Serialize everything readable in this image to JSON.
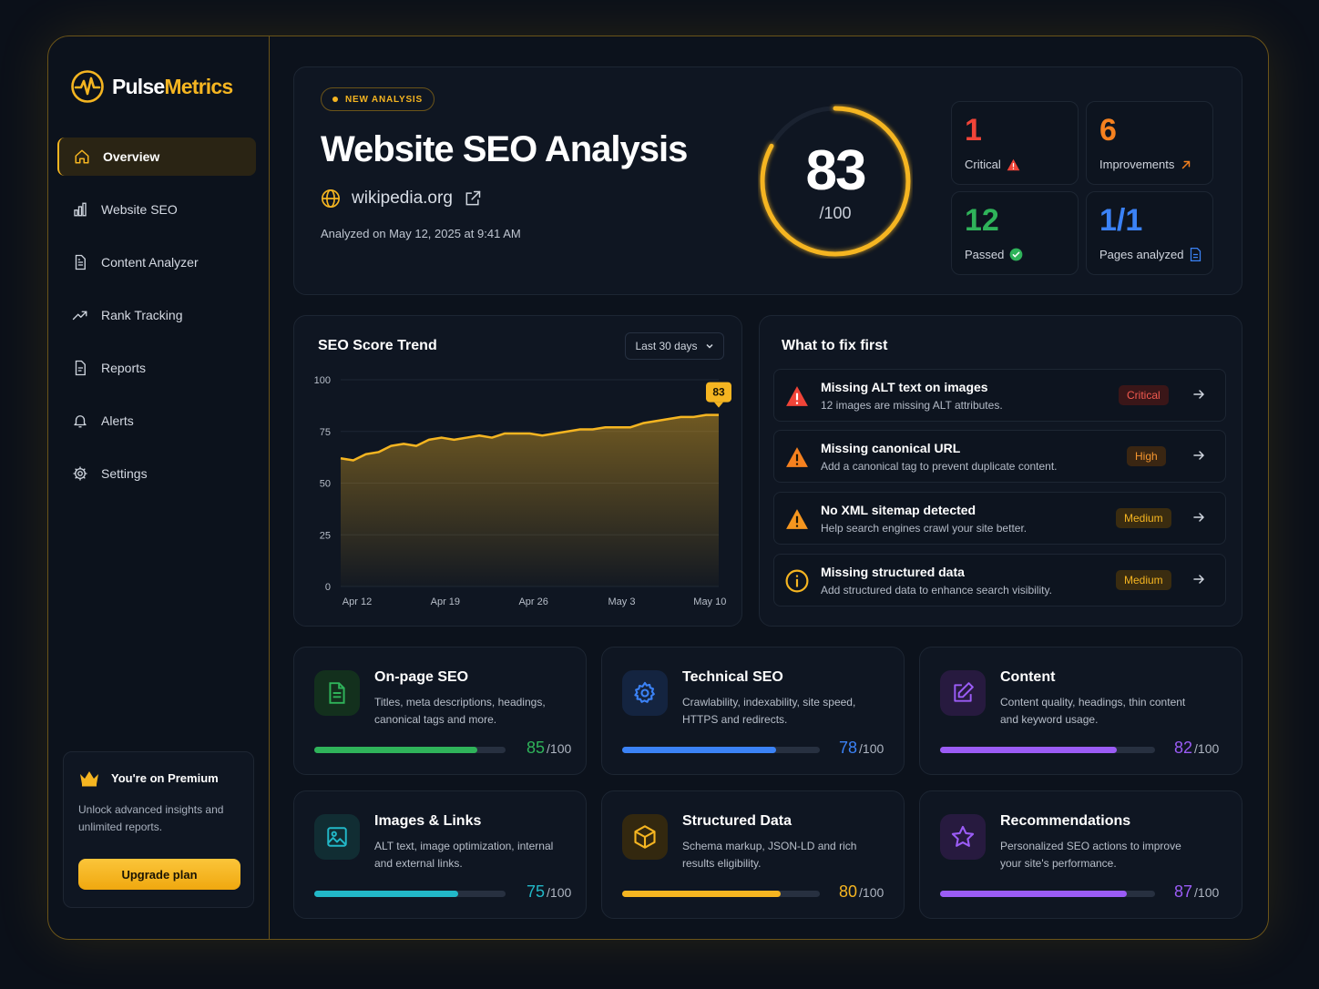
{
  "brand": {
    "name_a": "Pulse",
    "name_b": "Metrics",
    "accent": "#f5b521"
  },
  "nav": {
    "items": [
      {
        "label": "Overview",
        "icon": "home-icon",
        "active": true
      },
      {
        "label": "Website SEO",
        "icon": "bar-chart-icon"
      },
      {
        "label": "Content Analyzer",
        "icon": "document-icon"
      },
      {
        "label": "Rank Tracking",
        "icon": "trending-up-icon"
      },
      {
        "label": "Reports",
        "icon": "report-icon"
      },
      {
        "label": "Alerts",
        "icon": "bell-icon"
      },
      {
        "label": "Settings",
        "icon": "gear-icon"
      }
    ]
  },
  "premium": {
    "title": "You're on Premium",
    "description": "Unlock advanced insights and unlimited reports.",
    "button": "Upgrade plan"
  },
  "hero": {
    "badge": "NEW ANALYSIS",
    "title": "Website SEO Analysis",
    "site": "wikipedia.org",
    "analyzed": "Analyzed on May 12, 2025 at 9:41 AM",
    "score": "83",
    "score_den": "/100",
    "score_fraction": 0.83
  },
  "stats": [
    {
      "value": "1",
      "label": "Critical",
      "color": "#f04438",
      "icon": "warning-icon"
    },
    {
      "value": "6",
      "label": "Improvements",
      "color": "#f5811f",
      "icon": "arrow-up-right-icon"
    },
    {
      "value": "12",
      "label": "Passed",
      "color": "#2fb35a",
      "icon": "check-circle-icon"
    },
    {
      "value": "1/1",
      "label": "Pages analyzed",
      "color": "#3b82f6",
      "icon": "page-icon"
    }
  ],
  "trend": {
    "title": "SEO Score Trend",
    "range": "Last 30 days",
    "latest_label": "83"
  },
  "chart_data": {
    "type": "area",
    "x": [
      "Apr 12",
      "Apr 13",
      "Apr 14",
      "Apr 15",
      "Apr 16",
      "Apr 17",
      "Apr 18",
      "Apr 19",
      "Apr 20",
      "Apr 21",
      "Apr 22",
      "Apr 23",
      "Apr 24",
      "Apr 25",
      "Apr 26",
      "Apr 27",
      "Apr 28",
      "Apr 29",
      "Apr 30",
      "May 1",
      "May 2",
      "May 3",
      "May 4",
      "May 5",
      "May 6",
      "May 7",
      "May 8",
      "May 9",
      "May 10",
      "May 11",
      "May 12"
    ],
    "values": [
      62,
      61,
      64,
      65,
      68,
      69,
      68,
      71,
      72,
      71,
      72,
      73,
      72,
      74,
      74,
      74,
      73,
      74,
      75,
      76,
      76,
      77,
      77,
      77,
      79,
      80,
      81,
      82,
      82,
      83,
      83
    ],
    "xticks": [
      "Apr 12",
      "Apr 19",
      "Apr 26",
      "May 3",
      "May 10"
    ],
    "yticks": [
      0,
      25,
      50,
      75,
      100
    ],
    "ylim": [
      0,
      100
    ],
    "title": "SEO Score Trend",
    "grid": true,
    "color": "#f5b521"
  },
  "fix": {
    "title": "What to fix first",
    "items": [
      {
        "title": "Missing ALT text on images",
        "desc": "12 images are missing ALT attributes.",
        "severity": "Critical",
        "icon": "warning-icon"
      },
      {
        "title": "Missing canonical URL",
        "desc": "Add a canonical tag to prevent duplicate content.",
        "severity": "High",
        "icon": "warning-icon"
      },
      {
        "title": "No XML sitemap detected",
        "desc": "Help search engines crawl your site better.",
        "severity": "Medium",
        "icon": "warning-icon"
      },
      {
        "title": "Missing structured data",
        "desc": "Add structured data to enhance search visibility.",
        "severity": "Medium",
        "icon": "info-icon"
      }
    ]
  },
  "categories": [
    {
      "title": "On-page SEO",
      "desc": "Titles, meta descriptions, headings, canonical tags and more.",
      "score": "85",
      "den": "/100",
      "fraction": 0.85,
      "color": "#2fb35a",
      "icon": "document-icon"
    },
    {
      "title": "Technical SEO",
      "desc": "Crawlability, indexability, site speed, HTTPS and redirects.",
      "score": "78",
      "den": "/100",
      "fraction": 0.78,
      "color": "#3b82f6",
      "icon": "gear-icon"
    },
    {
      "title": "Content",
      "desc": "Content quality, headings, thin content and keyword usage.",
      "score": "82",
      "den": "/100",
      "fraction": 0.82,
      "color": "#9b5cf6",
      "icon": "edit-icon"
    },
    {
      "title": "Images & Links",
      "desc": "ALT text, image optimization, internal and external links.",
      "score": "75",
      "den": "/100",
      "fraction": 0.75,
      "color": "#22b8c8",
      "icon": "image-icon"
    },
    {
      "title": "Structured Data",
      "desc": "Schema markup, JSON-LD and rich results eligibility.",
      "score": "80",
      "den": "/100",
      "fraction": 0.8,
      "color": "#f5b521",
      "icon": "cube-icon"
    },
    {
      "title": "Recommendations",
      "desc": "Personalized SEO actions to improve your site's performance.",
      "score": "87",
      "den": "/100",
      "fraction": 0.87,
      "color": "#9b5cf6",
      "icon": "star-icon"
    }
  ]
}
